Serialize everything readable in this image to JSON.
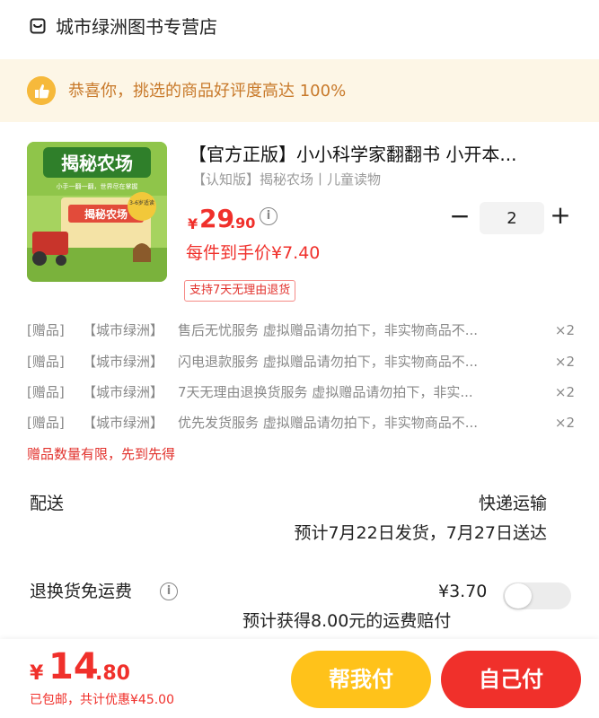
{
  "store": {
    "name": "城市绿洲图书专营店",
    "icon": "store-icon"
  },
  "banner": {
    "text": "恭喜你，挑选的商品好评度高达 100%",
    "icon": "thumbs-up-icon"
  },
  "product": {
    "title": "【官方正版】小小科学家翻翻书 小开本...",
    "spec": "【认知版】揭秘农场丨儿童读物",
    "price": {
      "currency": "¥",
      "integer": "29",
      "decimal": ".90"
    },
    "unit_price": "每件到手价¥7.40",
    "quantity": "2",
    "return_badge": "支持7天无理由退货",
    "cover": {
      "title": "揭秘农场",
      "subtitle": "小手一翻一翻，世界尽在掌握",
      "age_badge": "3-6岁适读",
      "inner_title": "揭秘农场"
    }
  },
  "gifts": [
    {
      "tag": "[赠品]",
      "shop": "【城市绿洲】",
      "desc": "售后无忧服务 虚拟赠品请勿拍下，非实物商品不...",
      "qty": "×2"
    },
    {
      "tag": "[赠品]",
      "shop": "【城市绿洲】",
      "desc": "闪电退款服务 虚拟赠品请勿拍下，非实物商品不...",
      "qty": "×2"
    },
    {
      "tag": "[赠品]",
      "shop": "【城市绿洲】",
      "desc": "7天无理由退换货服务 虚拟赠品请勿拍下，非实...",
      "qty": "×2"
    },
    {
      "tag": "[赠品]",
      "shop": "【城市绿洲】",
      "desc": "优先发货服务 虚拟赠品请勿拍下，非实物商品不...",
      "qty": "×2"
    }
  ],
  "gift_note": "赠品数量有限，先到先得",
  "delivery": {
    "label": "配送",
    "method": "快递运输",
    "eta": "预计7月22日发货，7月27日送达"
  },
  "return_freight": {
    "label": "退换货免运费",
    "price": "¥3.70",
    "compensation": "预计获得8.00元的运费赔付",
    "enabled": false
  },
  "total": {
    "currency": "¥",
    "integer": "14",
    "decimal": ".80",
    "sub": "已包邮，共计优惠¥45.00"
  },
  "buttons": {
    "help": "帮我付",
    "self": "自己付"
  },
  "colors": {
    "accent": "#f0302b",
    "yellow": "#ffc21a",
    "banner_bg": "#fdf6e6",
    "banner_text": "#c8792a"
  }
}
